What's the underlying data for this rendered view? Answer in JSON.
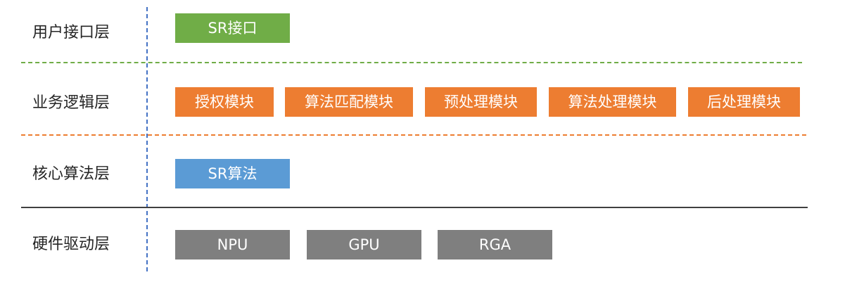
{
  "layers": [
    {
      "label": "用户接口层",
      "modules": [
        "SR接口"
      ],
      "color": "#70ad47"
    },
    {
      "label": "业务逻辑层",
      "modules": [
        "授权模块",
        "算法匹配模块",
        "预处理模块",
        "算法处理模块",
        "后处理模块"
      ],
      "color": "#ed7d31"
    },
    {
      "label": "核心算法层",
      "modules": [
        "SR算法"
      ],
      "color": "#5b9bd5"
    },
    {
      "label": "硬件驱动层",
      "modules": [
        "NPU",
        "GPU",
        "RGA"
      ],
      "color": "#7f7f7f"
    }
  ],
  "separators": {
    "divider_line_color": "#4472c4",
    "line1_color": "#70ad47",
    "line2_color": "#ed7d31",
    "line3_color": "#404040"
  }
}
